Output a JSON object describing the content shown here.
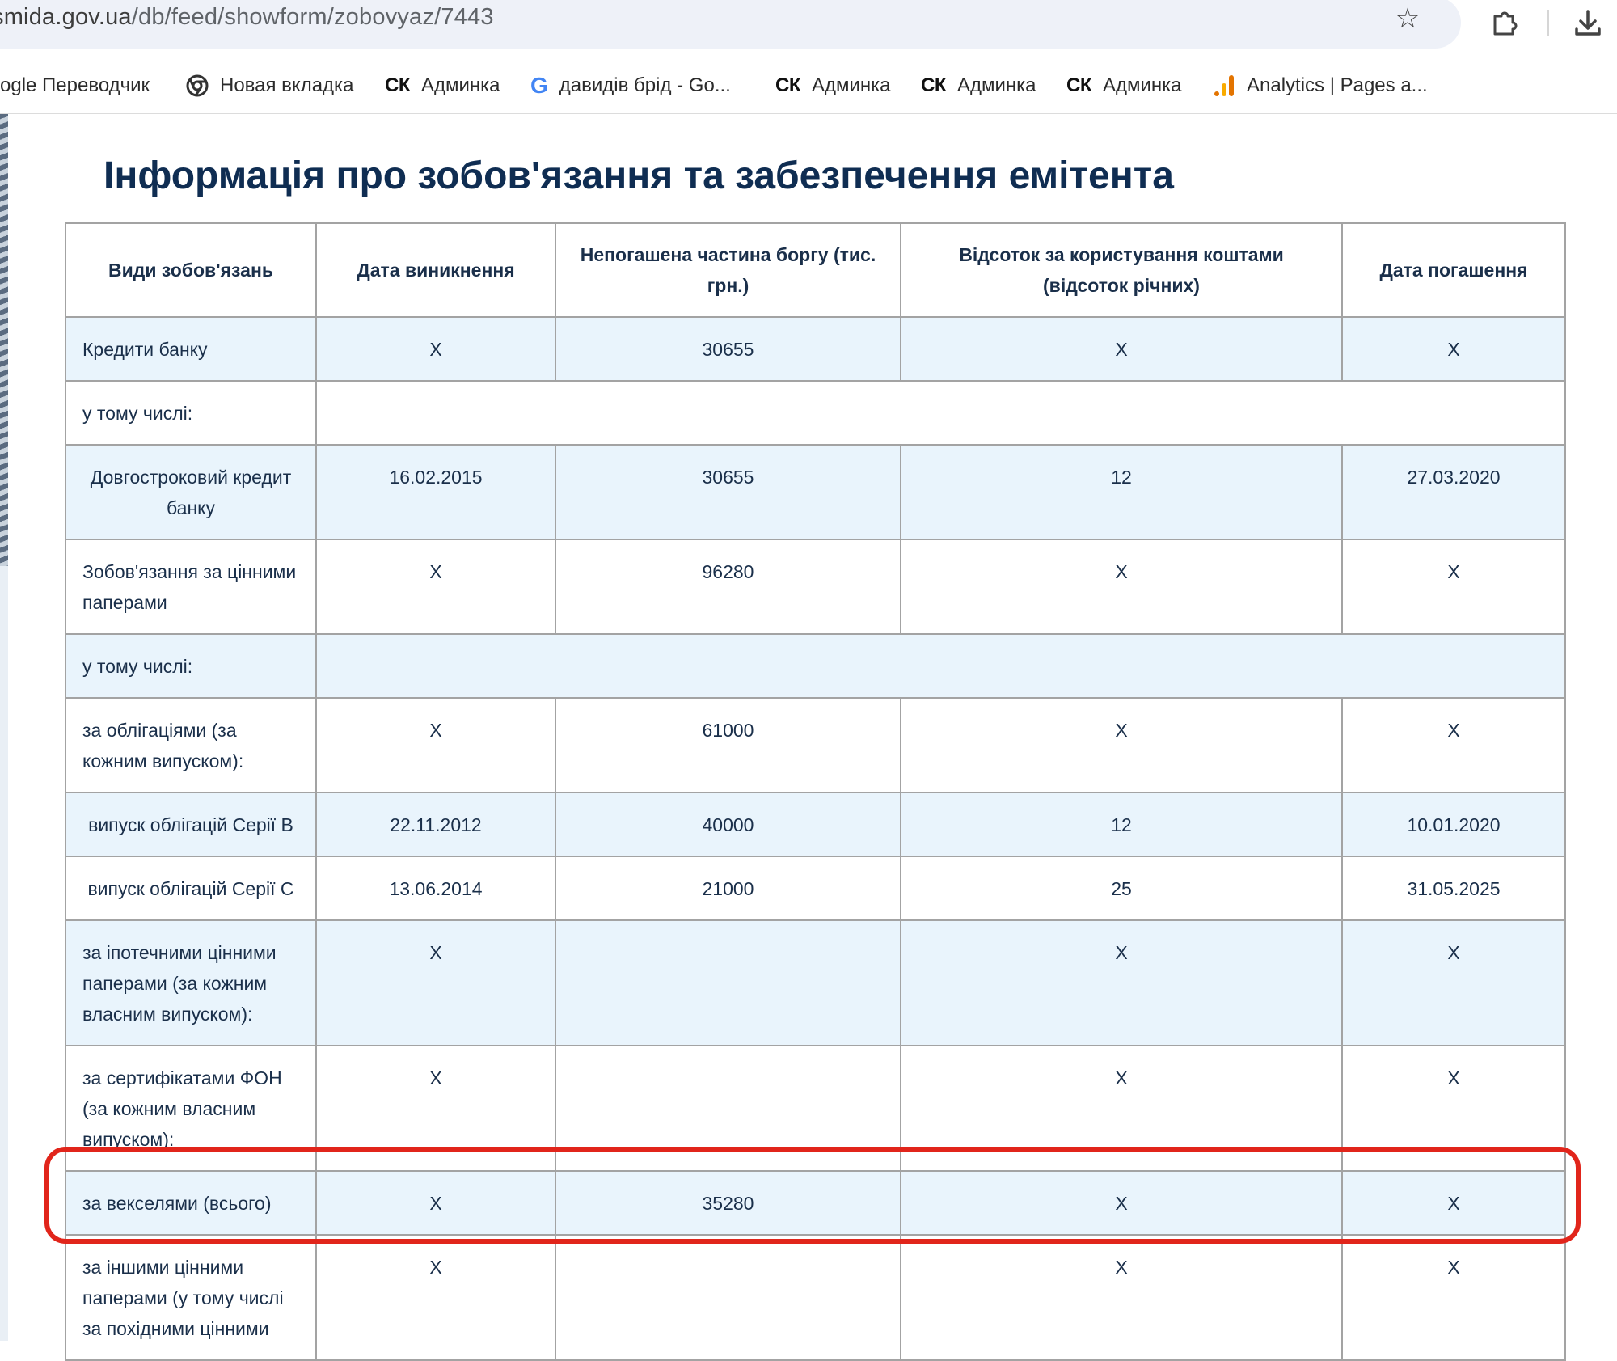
{
  "browser": {
    "url_host": "smida.gov.ua",
    "url_path": "/db/feed/showform/zobovyaz/7443",
    "bookmarks": [
      {
        "label": "ogle Переводчик",
        "icon": "none"
      },
      {
        "label": "Новая вкладка",
        "icon": "chrome-icon"
      },
      {
        "label": "Админка",
        "icon": "ck-logo",
        "logo_text": "СК"
      },
      {
        "label": "давидів брід - Go...",
        "icon": "google-icon",
        "logo_text": "G"
      },
      {
        "label": "Админка",
        "icon": "ck-logo",
        "logo_text": "СК"
      },
      {
        "label": "Админка",
        "icon": "ck-logo",
        "logo_text": "СК"
      },
      {
        "label": "Админка",
        "icon": "ck-logo",
        "logo_text": "СК"
      },
      {
        "label": "Analytics | Pages a...",
        "icon": "analytics-icon"
      }
    ],
    "star_glyph": "☆"
  },
  "page": {
    "title": "Інформація про зобов'язання та забезпечення емітента"
  },
  "table": {
    "headers": [
      "Види зобов'язань",
      "Дата виникнення",
      "Непогашена частина боргу (тис. грн.)",
      "Відсоток за користування коштами (відсоток річних)",
      "Дата погашення"
    ],
    "rows": [
      {
        "type": "Кредити банку",
        "date": "X",
        "debt": "30655",
        "rate": "X",
        "maturity": "X"
      },
      {
        "type": "у тому числі:"
      },
      {
        "type": "Довгостроковий кредит банку",
        "date": "16.02.2015",
        "debt": "30655",
        "rate": "12",
        "maturity": "27.03.2020"
      },
      {
        "type": "Зобов'язання за цінними паперами",
        "date": "X",
        "debt": "96280",
        "rate": "X",
        "maturity": "X"
      },
      {
        "type": "у тому числі:"
      },
      {
        "type": "за облігаціями (за кожним випуском):",
        "date": "X",
        "debt": "61000",
        "rate": "X",
        "maturity": "X"
      },
      {
        "type": "випуск облігацій Серії В",
        "date": "22.11.2012",
        "debt": "40000",
        "rate": "12",
        "maturity": "10.01.2020"
      },
      {
        "type": "випуск облігацій Серії С",
        "date": "13.06.2014",
        "debt": "21000",
        "rate": "25",
        "maturity": "31.05.2025"
      },
      {
        "type": "за іпотечними цінними паперами (за кожним власним випуском):",
        "date": "X",
        "debt": "",
        "rate": "X",
        "maturity": "X"
      },
      {
        "type": "за сертифікатами ФОН (за кожним власним випуском):",
        "date": "X",
        "debt": "",
        "rate": "X",
        "maturity": "X"
      },
      {
        "type": "за векселями (всього)",
        "date": "X",
        "debt": "35280",
        "rate": "X",
        "maturity": "X"
      },
      {
        "type": "за іншими цінними паперами (у тому числі за похідними цінними",
        "date": "X",
        "debt": "",
        "rate": "X",
        "maturity": "X"
      }
    ]
  },
  "colors": {
    "title": "#0f2d52",
    "row_shade": "#e9f4fc",
    "highlight": "#e1251b"
  }
}
